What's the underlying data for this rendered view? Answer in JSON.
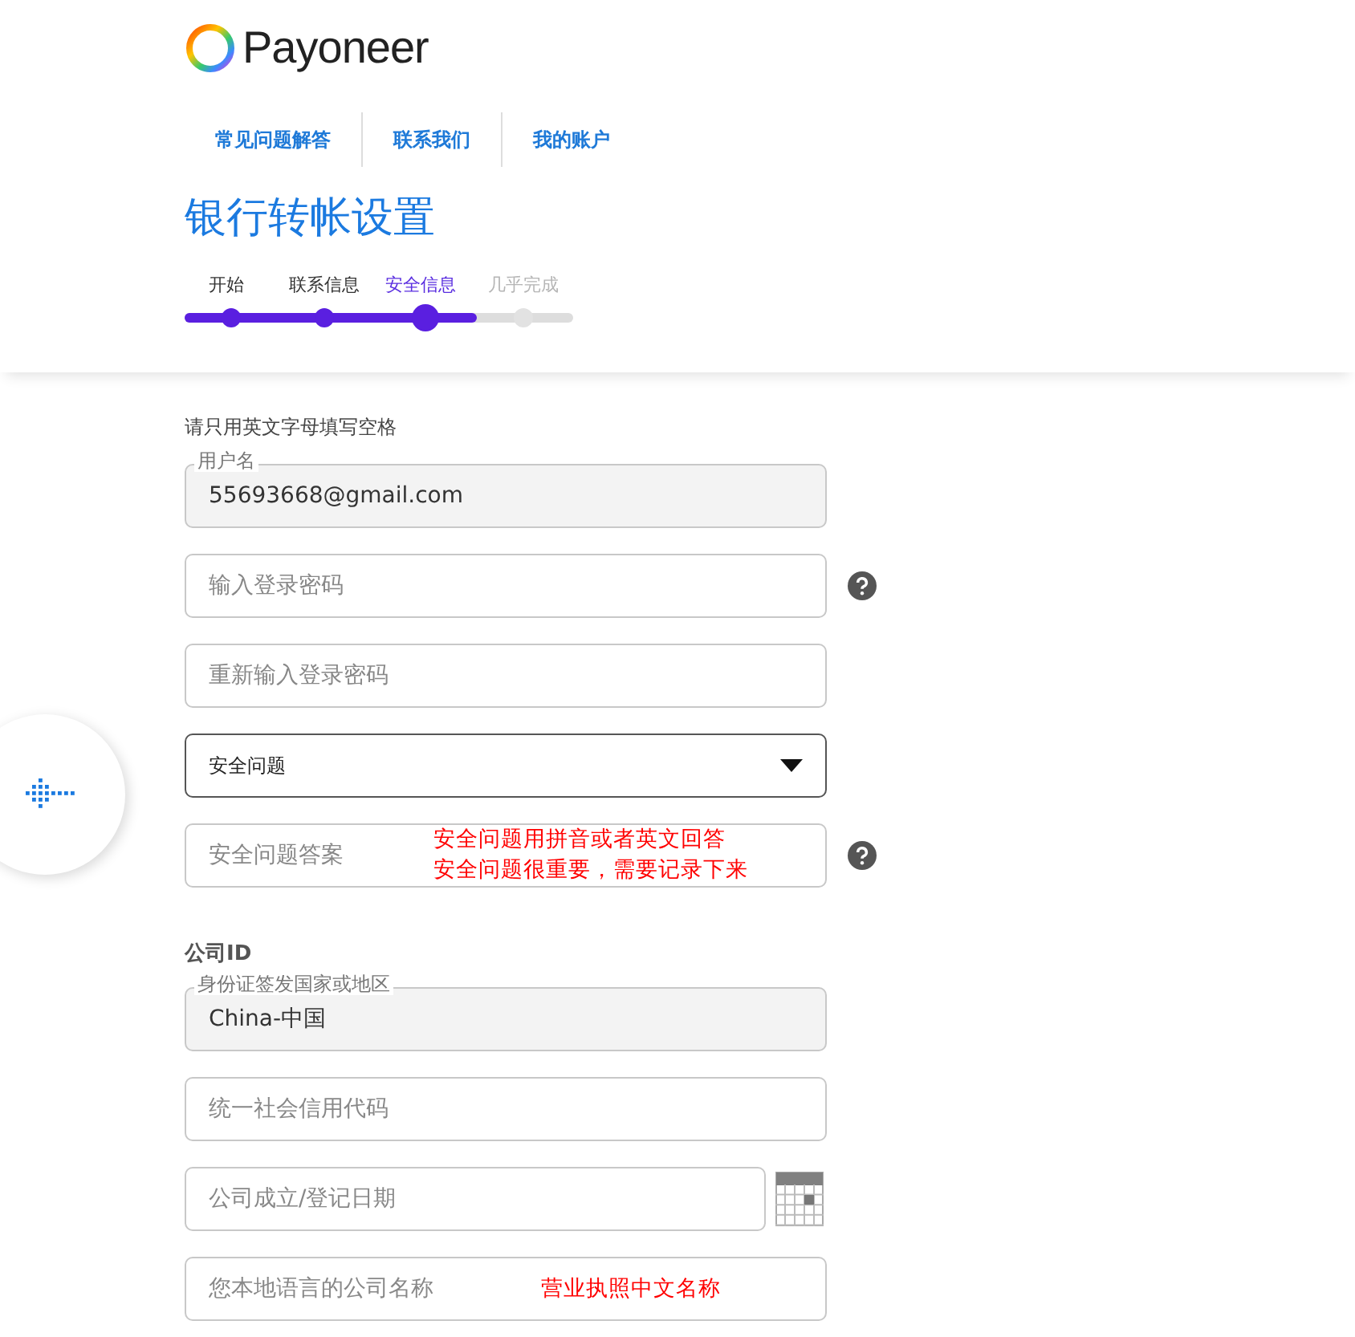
{
  "logo": {
    "text": "Payoneer"
  },
  "nav": [
    {
      "label": "常见问题解答"
    },
    {
      "label": "联系我们"
    },
    {
      "label": "我的账户"
    }
  ],
  "title": "银行转帐设置",
  "steps": [
    {
      "label": "开始",
      "done": true,
      "selected": false
    },
    {
      "label": "联系信息",
      "done": true,
      "selected": false
    },
    {
      "label": "安全信息",
      "done": true,
      "selected": true
    },
    {
      "label": "几乎完成",
      "done": false,
      "selected": false
    }
  ],
  "progress": {
    "level": 0.75
  },
  "form": [
    {
      "kind": "note",
      "text": "请只用英文字母填写空格"
    },
    {
      "kind": "filled",
      "label": "用户名",
      "value": "55693668@gmail.com"
    },
    {
      "kind": "input",
      "placeholder": "输入登录密码",
      "help": true
    },
    {
      "kind": "input",
      "placeholder": "重新输入登录密码"
    },
    {
      "kind": "select",
      "value": "安全问题"
    },
    {
      "kind": "input",
      "placeholder": "安全问题答案",
      "help": true,
      "annotation": [
        "安全问题用拼音或者英文回答",
        "安全问题很重要，需要记录下来"
      ]
    },
    {
      "kind": "heading",
      "text": "公司ID"
    },
    {
      "kind": "filled",
      "label": "身份证签发国家或地区",
      "value": "China-中国"
    },
    {
      "kind": "input",
      "placeholder": "统一社会信用代码"
    },
    {
      "kind": "input",
      "placeholder": "公司成立/登记日期",
      "calendar": true
    },
    {
      "kind": "input",
      "placeholder": "您本地语言的公司名称",
      "annotation": [
        "营业执照中文名称"
      ]
    }
  ]
}
